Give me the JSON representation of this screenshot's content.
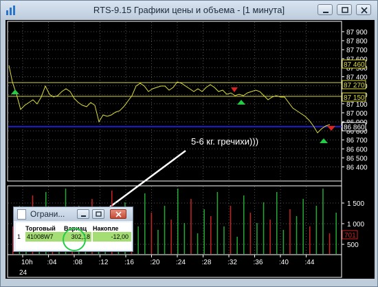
{
  "window": {
    "title": "RTS-9.15 Графики цены и объема - [1 минута]",
    "controls": [
      "minimize",
      "restore",
      "close"
    ]
  },
  "price_axis": {
    "labels": [
      "87 900",
      "87 800",
      "87 700",
      "87 600",
      "87 500",
      "87 400",
      "87 300",
      "87 200",
      "87 100",
      "87 000",
      "86 900",
      "86 800",
      "86 700",
      "86 600",
      "86 500",
      "86 400"
    ]
  },
  "price_tags": {
    "upper": "87 460",
    "mid_high": "87 270",
    "mid_low": "87 150",
    "current": "86 860"
  },
  "volume_axis": {
    "labels": [
      "1 500",
      "1 000",
      "500"
    ],
    "current_tag": "701"
  },
  "time_axis": {
    "labels": [
      "10h",
      ":04",
      ":08",
      ":12",
      ":16",
      ":20",
      ":24",
      ":28",
      ":32",
      ":36",
      ":40",
      ":44"
    ],
    "day": "24"
  },
  "annotation": {
    "text": "5-6 кг. гречихи)))"
  },
  "orders_window": {
    "title": "Ограни...",
    "columns": [
      "Торговый",
      "Вариац",
      "Накопле"
    ],
    "row": {
      "index": "1",
      "account": "41008W7",
      "variation": "302,18",
      "accumulated": "-12,00"
    }
  },
  "colors": {
    "price_line": "#dede3a",
    "level_line": "#0000cc",
    "up_marker": "#22cc44",
    "down_marker": "#dd2222",
    "volume_up": "#22aa33",
    "volume_down": "#cc2222"
  }
}
